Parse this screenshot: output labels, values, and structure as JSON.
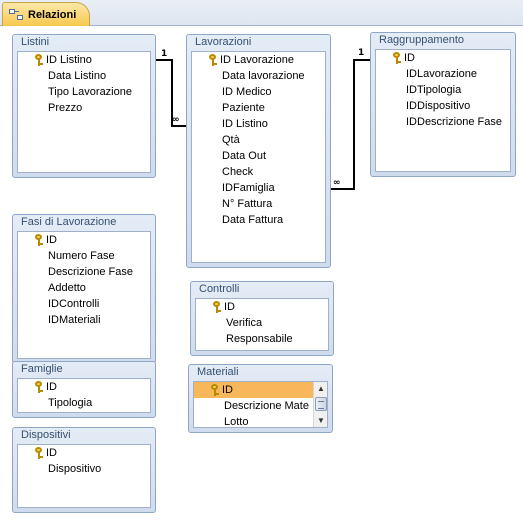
{
  "tab": {
    "label": "Relazioni",
    "icon": "relationships-icon"
  },
  "tables": {
    "listini": {
      "title": "Listini",
      "fields": [
        "ID Listino",
        "Data Listino",
        "Tipo Lavorazione",
        "Prezzo"
      ]
    },
    "lavorazioni": {
      "title": "Lavorazioni",
      "fields": [
        "ID Lavorazione",
        "Data lavorazione",
        "ID Medico",
        "Paziente",
        "ID Listino",
        "Qtà",
        "Data Out",
        "Check",
        "IDFamiglia",
        "N° Fattura",
        "Data Fattura"
      ]
    },
    "raggruppamento": {
      "title": "Raggruppamento",
      "fields": [
        "ID",
        "IDLavorazione",
        "IDTipologia",
        "IDDispositivo",
        "IDDescrizione Fase"
      ]
    },
    "fasi": {
      "title": "Fasi di Lavorazione",
      "fields": [
        "ID",
        "Numero Fase",
        "Descrizione Fase",
        "Addetto",
        "IDControlli",
        "IDMateriali"
      ]
    },
    "controlli": {
      "title": "Controlli",
      "fields": [
        "ID",
        "Verifica",
        "Responsabile"
      ]
    },
    "famiglie": {
      "title": "Famiglie",
      "fields": [
        "ID",
        "Tipologia"
      ]
    },
    "materiali": {
      "title": "Materiali",
      "fields": [
        "ID",
        "Descrizione Mate",
        "Lotto"
      ]
    },
    "dispositivi": {
      "title": "Dispositivi",
      "fields": [
        "ID",
        "Dispositivo"
      ]
    }
  },
  "relationships": [
    {
      "from": "Listini",
      "one": "1",
      "to": "Lavorazioni",
      "many": "∞"
    },
    {
      "from": "Raggruppamento",
      "one": "1",
      "to": "Lavorazioni",
      "many": "∞"
    }
  ],
  "colors": {
    "selected": "#f9b75c",
    "tab": "#f7c84e",
    "window_border": "#8ea7c8"
  }
}
